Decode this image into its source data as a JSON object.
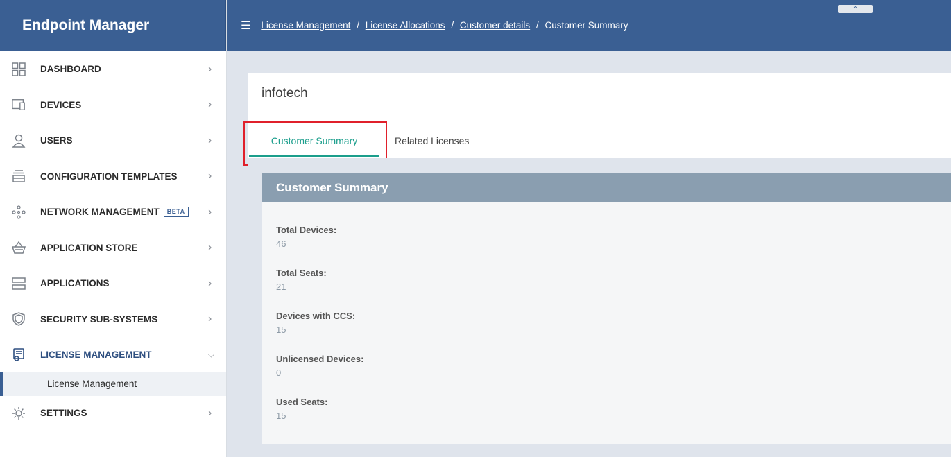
{
  "app": {
    "title": "Endpoint Manager"
  },
  "breadcrumb": {
    "items": [
      "License Management",
      "License Allocations",
      "Customer details"
    ],
    "current": "Customer Summary",
    "separator": "/"
  },
  "sidebar": {
    "items": [
      {
        "label": "DASHBOARD",
        "icon": "dashboard-icon"
      },
      {
        "label": "DEVICES",
        "icon": "devices-icon"
      },
      {
        "label": "USERS",
        "icon": "user-icon"
      },
      {
        "label": "CONFIGURATION TEMPLATES",
        "icon": "templates-icon"
      },
      {
        "label": "NETWORK MANAGEMENT",
        "icon": "network-icon",
        "badge": "BETA"
      },
      {
        "label": "APPLICATION STORE",
        "icon": "store-icon"
      },
      {
        "label": "APPLICATIONS",
        "icon": "applications-icon"
      },
      {
        "label": "SECURITY SUB-SYSTEMS",
        "icon": "shield-icon"
      },
      {
        "label": "LICENSE MANAGEMENT",
        "icon": "license-icon",
        "expanded": true
      },
      {
        "label": "SETTINGS",
        "icon": "gear-icon"
      }
    ],
    "sub_item": "License Management"
  },
  "page": {
    "company": "infotech",
    "tabs": [
      "Customer Summary",
      "Related Licenses"
    ],
    "active_tab": "Customer Summary"
  },
  "summary": {
    "title": "Customer Summary",
    "stats": [
      {
        "label": "Total Devices:",
        "value": "46"
      },
      {
        "label": "Total Seats:",
        "value": "21"
      },
      {
        "label": "Devices with CCS:",
        "value": "15"
      },
      {
        "label": "Unlicensed Devices:",
        "value": "0"
      },
      {
        "label": "Used Seats:",
        "value": "15"
      }
    ]
  },
  "colors": {
    "header": "#3a5f93",
    "accent_tab": "#1b9e8c",
    "card_header": "#8a9eb0",
    "highlight": "#e0202b"
  }
}
